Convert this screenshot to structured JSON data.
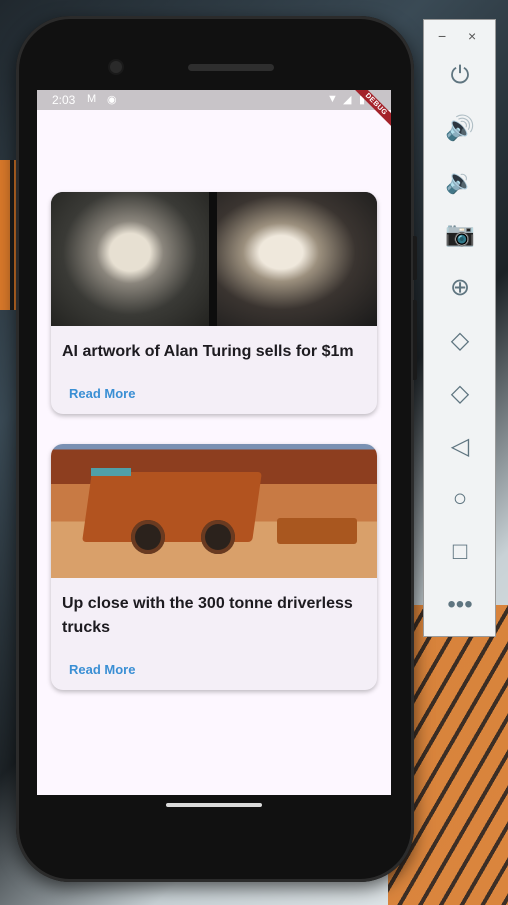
{
  "status_bar": {
    "time": "2:03",
    "debug_label": "DEBUG"
  },
  "articles": [
    {
      "title": "AI artwork of Alan Turing sells for $1m",
      "read_more": "Read More",
      "image": "turing-artwork"
    },
    {
      "title": "Up close with the 300 tonne driverless trucks",
      "read_more": "Read More",
      "image": "driverless-trucks"
    }
  ],
  "emulator_panel": {
    "minimize": "−",
    "close": "×",
    "buttons": [
      "power-icon",
      "volume-up-icon",
      "volume-down-icon",
      "camera-icon",
      "zoom-icon",
      "rotate-left-icon",
      "rotate-right-icon",
      "back-icon",
      "home-icon",
      "overview-icon",
      "more-icon"
    ]
  },
  "colors": {
    "screen_bg": "#fdf7ff",
    "card_bg": "#f4eff7",
    "link": "#3a8fd4",
    "debug_banner": "#a4222a"
  }
}
